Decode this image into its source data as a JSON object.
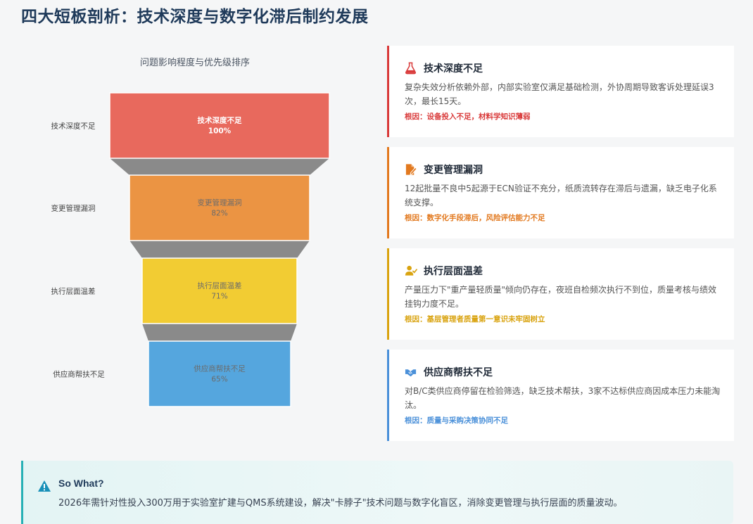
{
  "page": {
    "title": "四大短板剖析：技术深度与数字化滞后制约发展"
  },
  "chart_data": {
    "type": "funnel",
    "title": "问题影响程度与优先级排序",
    "categories": [
      "技术深度不足",
      "变更管理漏洞",
      "执行层面温差",
      "供应商帮扶不足"
    ],
    "values": [
      100,
      82,
      71,
      65
    ],
    "value_labels": [
      "100%",
      "82%",
      "71%",
      "65%"
    ],
    "colors": [
      "#e8695d",
      "#eb9443",
      "#f2cc33",
      "#55a6de"
    ],
    "connector_color": "#8a8a8a"
  },
  "cards": [
    {
      "title": "技术深度不足",
      "icon": "flask-icon",
      "color": "#d93a3a",
      "desc": "复杂失效分析依赖外部，内部实验室仅满足基础检测，外协周期导致客诉处理延误3次，最长15天。",
      "cause": "根因：设备投入不足，材料学知识薄弱"
    },
    {
      "title": "变更管理漏洞",
      "icon": "file-edit-icon",
      "color": "#e2791f",
      "desc": "12起批量不良中5起源于ECN验证不充分，纸质流转存在滞后与遗漏，缺乏电子化系统支撑。",
      "cause": "根因：数字化手段滞后，风险评估能力不足"
    },
    {
      "title": "执行层面温差",
      "icon": "user-check-icon",
      "color": "#d9a30f",
      "desc": "产量压力下\"重产量轻质量\"倾向仍存在，夜班自检频次执行不到位，质量考核与绩效挂钩力度不足。",
      "cause": "根因：基层管理者质量第一意识未牢固树立"
    },
    {
      "title": "供应商帮扶不足",
      "icon": "handshake-icon",
      "color": "#4a90d9",
      "desc": "对B/C类供应商停留在检验筛选，缺乏技术帮扶，3家不达标供应商因成本压力未能淘汰。",
      "cause": "根因：质量与采购决策协同不足"
    }
  ],
  "sowhat": {
    "title": "So What?",
    "text": "2026年需针对性投入300万用于实验室扩建与QMS系统建设，解决\"卡脖子\"技术问题与数字化盲区，消除变更管理与执行层面的质量波动。"
  }
}
